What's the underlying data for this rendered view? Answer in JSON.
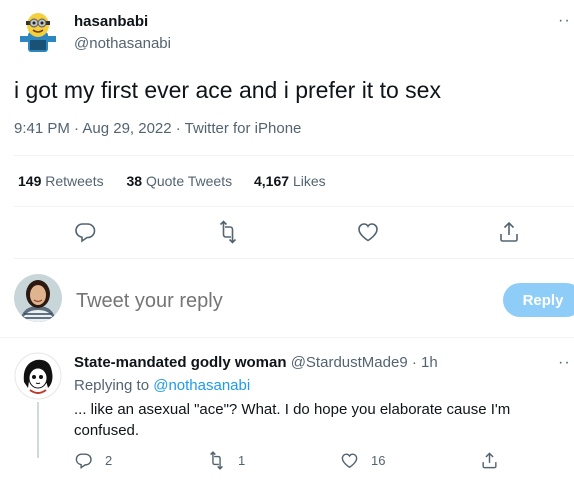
{
  "tweet": {
    "author_name": "hasanbabi",
    "author_handle": "@nothasanabi",
    "text": "i got my first ever ace and i prefer it to sex",
    "meta": "9:41 PM · Aug 29, 2022 · Twitter for iPhone",
    "more": "··",
    "stats": [
      {
        "num": "149",
        "label": "Retweets"
      },
      {
        "num": "38",
        "label": "Quote Tweets"
      },
      {
        "num": "4,167",
        "label": "Likes"
      }
    ],
    "actions": [
      "reply-icon",
      "retweet-icon",
      "like-icon",
      "share-icon"
    ]
  },
  "composer": {
    "placeholder": "Tweet your reply",
    "button_label": "Reply",
    "button_color": "#8ecdf8"
  },
  "reply": {
    "name": "State-mandated godly woman",
    "handle_time": "@StardustMade9 · 1h",
    "replying_prefix": "Replying to",
    "replying_handle": "@nothasanabi",
    "text": "... like an asexual \"ace\"? What.  I do hope you elaborate cause I'm confused.",
    "more": "··",
    "counts": {
      "replies": "2",
      "retweets": "1",
      "likes": "16"
    }
  },
  "colors": {
    "accent": "#1d9bf0",
    "muted": "#536471",
    "text": "#0f1419"
  }
}
